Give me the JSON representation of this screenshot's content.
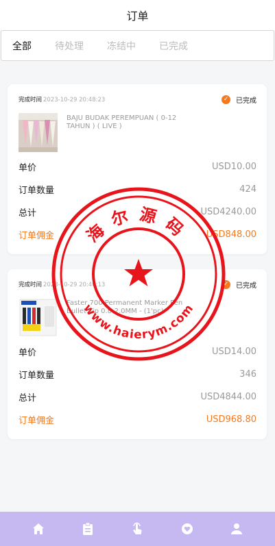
{
  "header": {
    "title": "订单"
  },
  "tabs": [
    {
      "label": "全部"
    },
    {
      "label": "待处理"
    },
    {
      "label": "冻结中"
    },
    {
      "label": "已完成"
    }
  ],
  "orders": [
    {
      "time_label": "完成时间",
      "time": "2023-10-29 20:48:23",
      "status": "已完成",
      "product_name": "BAJU BUDAK PEREMPUAN ( 0-12 TAHUN ) ( LIVE )",
      "rows": [
        {
          "label": "单价",
          "value": "USD10.00"
        },
        {
          "label": "订单数量",
          "value": "424"
        },
        {
          "label": "总计",
          "value": "USD4240.00"
        },
        {
          "label": "订单佣金",
          "value": "USD848.00"
        }
      ]
    },
    {
      "time_label": "完成时间",
      "time": "2023-10-29 20:40:13",
      "status": "已完成",
      "product_name": "Faster 700 Permanent Marker Pen Bullet Tip 0.8-2.0MM - (1'pc)",
      "rows": [
        {
          "label": "单价",
          "value": "USD14.00"
        },
        {
          "label": "订单数量",
          "value": "346"
        },
        {
          "label": "总计",
          "value": "USD4844.00"
        },
        {
          "label": "订单佣金",
          "value": "USD968.80"
        }
      ]
    }
  ],
  "watermark": {
    "top_text": "海尔源码",
    "bottom_text": "www.haierym.com",
    "color": "#e8141b"
  },
  "nav": [
    {
      "icon": "home-icon"
    },
    {
      "icon": "clipboard-icon"
    },
    {
      "icon": "tap-icon"
    },
    {
      "icon": "heart-diamond-icon"
    },
    {
      "icon": "user-icon"
    }
  ],
  "colors": {
    "accent": "#f47a1f",
    "nav_bg": "#c6b9f2"
  }
}
